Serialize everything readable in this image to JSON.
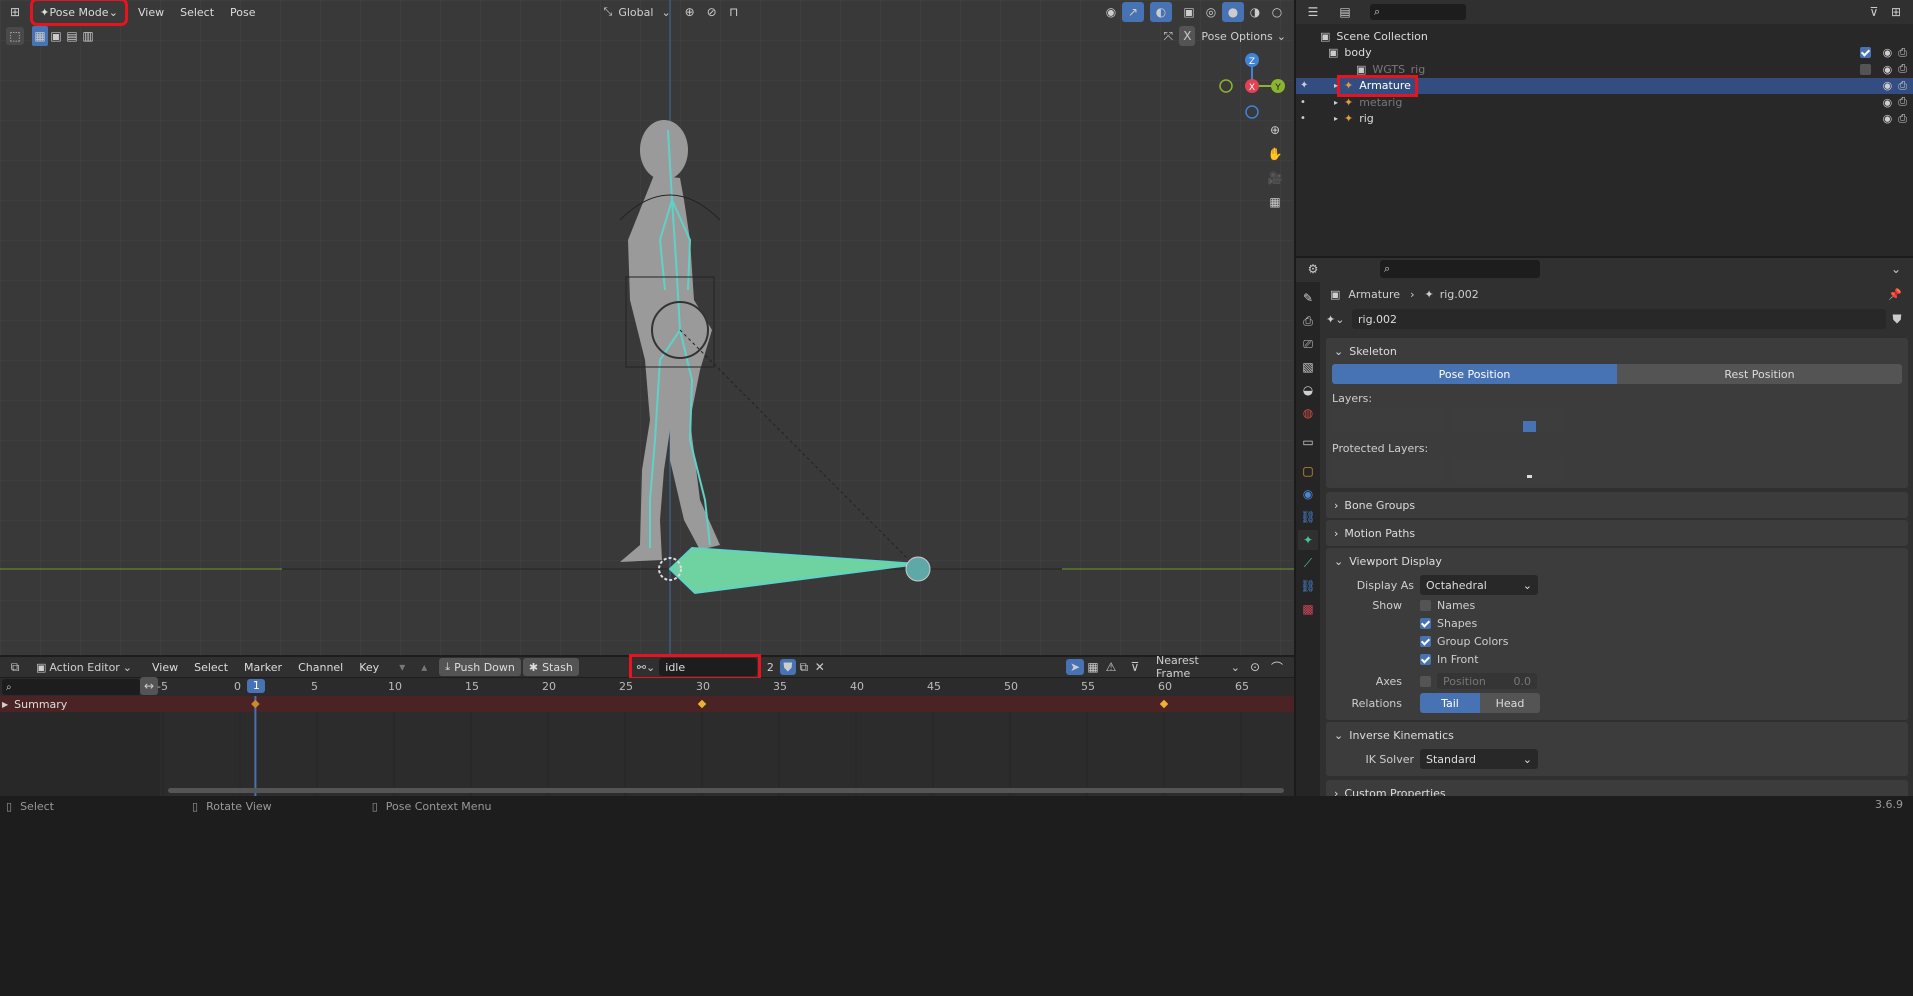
{
  "viewport": {
    "mode": "Pose Mode",
    "menus": [
      "View",
      "Select",
      "Pose"
    ],
    "orientation": "Global",
    "pose_options": "Pose Options",
    "gizmo": {
      "z": "Z",
      "x": "X",
      "y": "Y"
    },
    "colors": {
      "bg": "#393939",
      "grid": "#424242",
      "bone": "#5fd2c8",
      "bone_fill": "#6ed3a0",
      "model": "#9a9a9a"
    }
  },
  "outliner": {
    "rows": [
      {
        "label": "Scene Collection",
        "icon": "collection-icon"
      },
      {
        "label": "body",
        "icon": "collection-icon"
      },
      {
        "label": "WGTS_rig",
        "icon": "collection-icon"
      },
      {
        "label": "Armature",
        "icon": "armature-icon",
        "selected": true
      },
      {
        "label": "metarig",
        "icon": "armature-icon"
      },
      {
        "label": "rig",
        "icon": "armature-icon"
      }
    ]
  },
  "properties": {
    "breadcrumb": {
      "object": "Armature",
      "data": "rig.002"
    },
    "datablock": "rig.002",
    "skeleton": {
      "title": "Skeleton",
      "pose_position": "Pose Position",
      "rest_position": "Rest Position",
      "layers_label": "Layers:",
      "protected_label": "Protected Layers:"
    },
    "bone_groups": "Bone Groups",
    "motion_paths": "Motion Paths",
    "viewport_display": {
      "title": "Viewport Display",
      "display_as_label": "Display As",
      "display_as_value": "Octahedral",
      "show_label": "Show",
      "names": "Names",
      "shapes": "Shapes",
      "group_colors": "Group Colors",
      "in_front": "In Front",
      "axes_label": "Axes",
      "position_label": "Position",
      "position_value": "0.0",
      "relations_label": "Relations",
      "tail": "Tail",
      "head": "Head"
    },
    "inverse_kinematics": {
      "title": "Inverse Kinematics",
      "ik_label": "IK Solver",
      "ik_value": "Standard"
    },
    "custom_properties": "Custom Properties"
  },
  "action_editor": {
    "editor": "Action Editor",
    "menus": [
      "View",
      "Select",
      "Marker",
      "Channel",
      "Key"
    ],
    "push_down": "Push Down",
    "stash": "Stash",
    "action_name": "idle",
    "users": "2",
    "snap": "Nearest Frame",
    "ruler": [
      "-5",
      "0",
      "5",
      "10",
      "15",
      "20",
      "25",
      "30",
      "35",
      "40",
      "45",
      "50",
      "55",
      "60",
      "65"
    ],
    "current_frame": "1",
    "channel": "Summary",
    "keyframes": [
      1,
      30,
      60
    ]
  },
  "status": {
    "select": "Select",
    "rotate": "Rotate View",
    "context": "Pose Context Menu",
    "version": "3.6.9"
  }
}
